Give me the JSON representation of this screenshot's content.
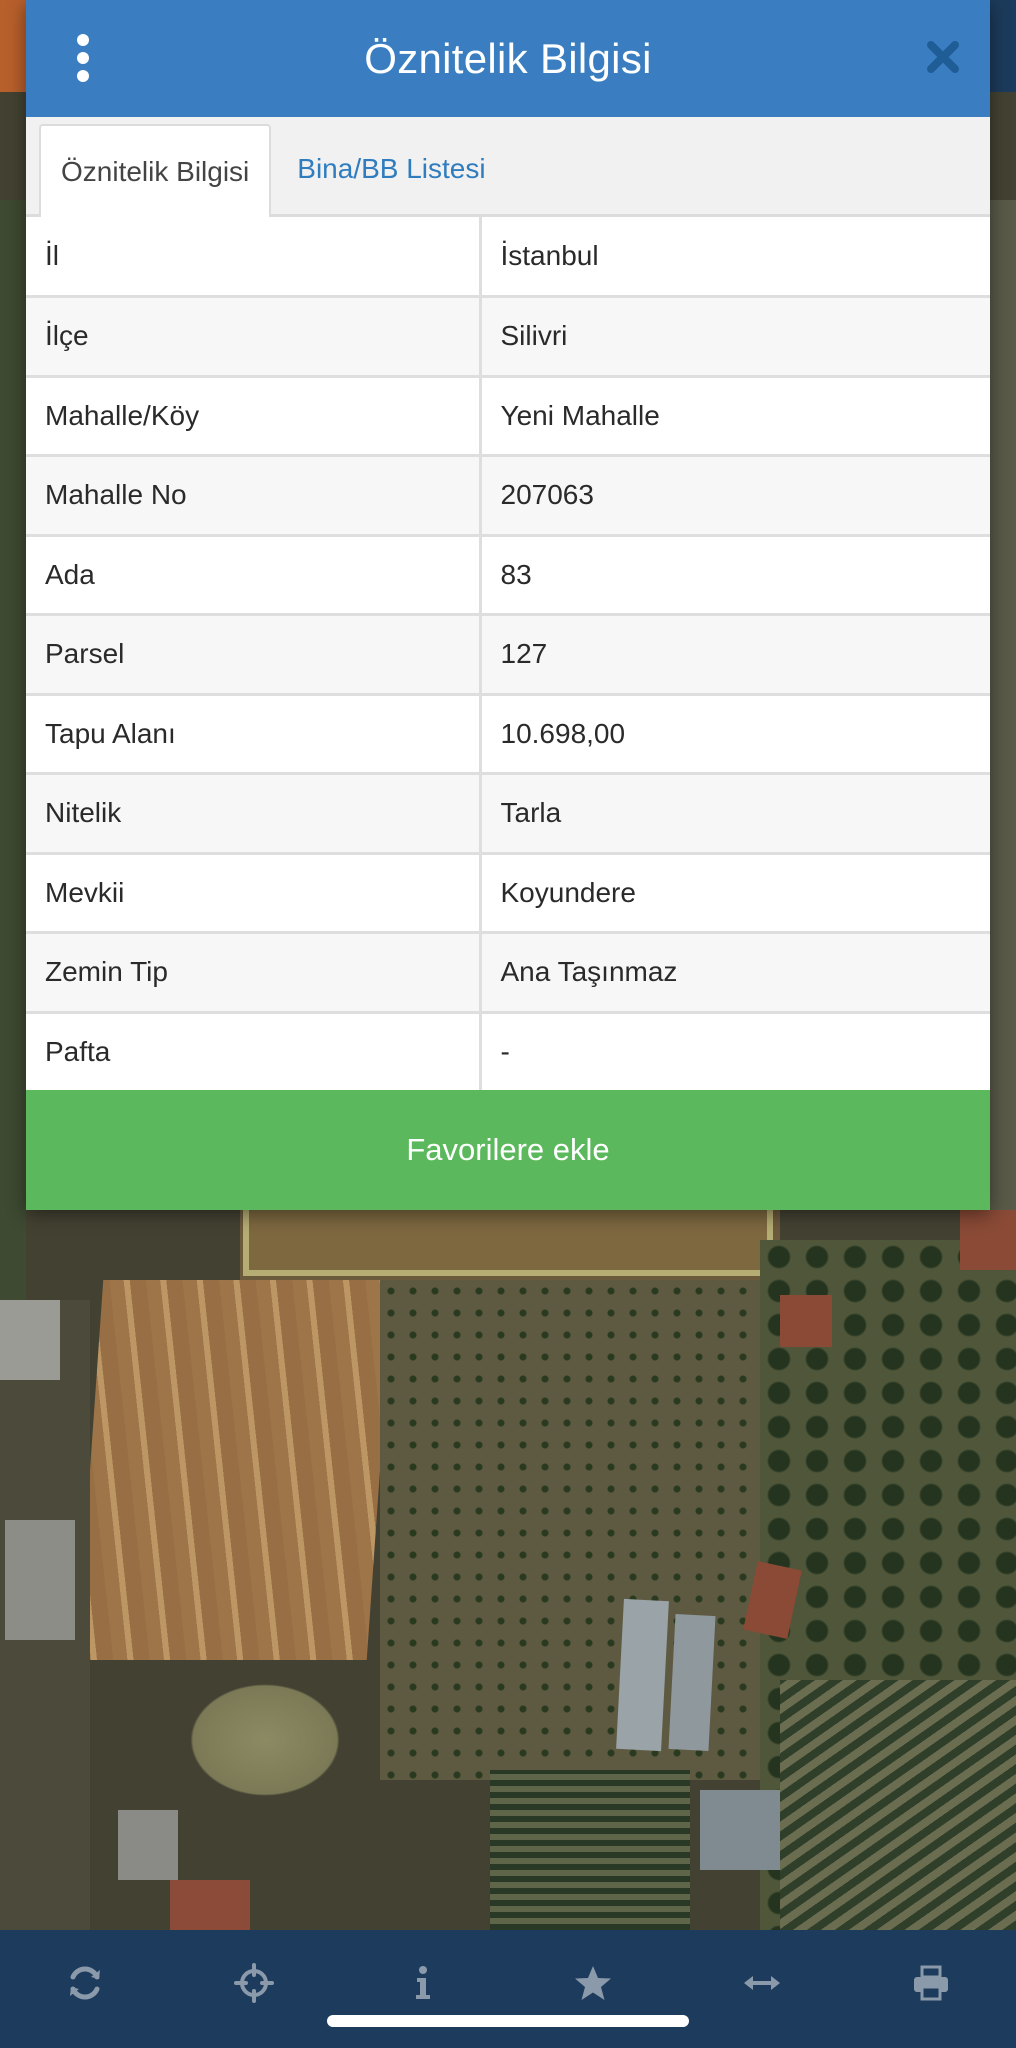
{
  "modal": {
    "title": "Öznitelik Bilgisi",
    "tabs": [
      {
        "label": "Öznitelik Bilgisi",
        "active": true
      },
      {
        "label": "Bina/BB Listesi",
        "active": false
      }
    ],
    "rows": [
      {
        "key": "İl",
        "value": "İstanbul"
      },
      {
        "key": "İlçe",
        "value": "Silivri"
      },
      {
        "key": "Mahalle/Köy",
        "value": "Yeni Mahalle"
      },
      {
        "key": "Mahalle No",
        "value": "207063"
      },
      {
        "key": "Ada",
        "value": "83"
      },
      {
        "key": "Parsel",
        "value": "127"
      },
      {
        "key": "Tapu Alanı",
        "value": "10.698,00"
      },
      {
        "key": "Nitelik",
        "value": "Tarla"
      },
      {
        "key": "Mevkii",
        "value": "Koyundere"
      },
      {
        "key": "Zemin Tip",
        "value": "Ana Taşınmaz"
      },
      {
        "key": "Pafta",
        "value": "-"
      }
    ],
    "favorite_button": "Favorilere ekle"
  },
  "toolbar": {
    "icons": [
      "refresh-icon",
      "crosshair-icon",
      "info-icon",
      "star-icon",
      "measure-icon",
      "print-icon"
    ]
  },
  "colors": {
    "header": "#3a7ec1",
    "toolbar": "#1d3b5c",
    "favorite": "#5cb85c",
    "tab_link": "#2f7cbf",
    "icon": "#8a9aaa"
  }
}
